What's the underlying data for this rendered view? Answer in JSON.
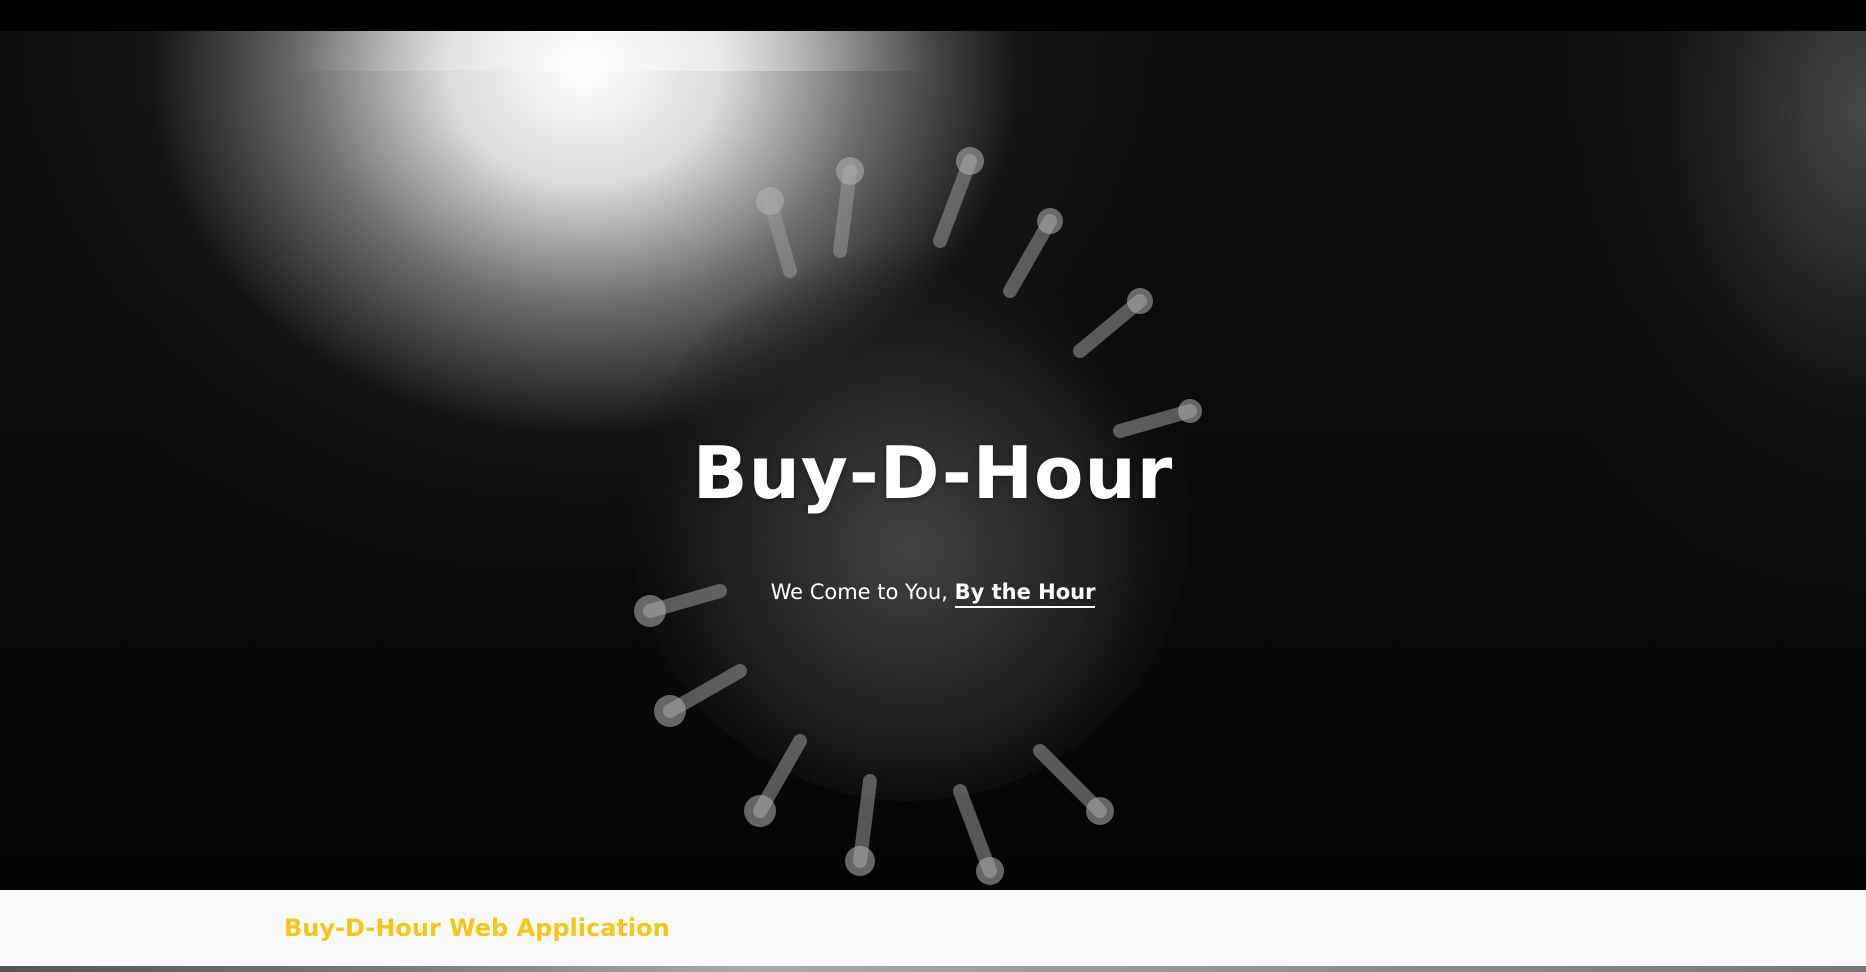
{
  "hero": {
    "title": "Buy-D-Hour",
    "subtitle_prefix": "We Come to You,",
    "subtitle_link": "By the Hour"
  },
  "section": {
    "title": "Buy-D-Hour Web Application"
  },
  "colors": {
    "accent": "#f5c518",
    "hero_text": "#ffffff",
    "top_bar": "#000000"
  }
}
